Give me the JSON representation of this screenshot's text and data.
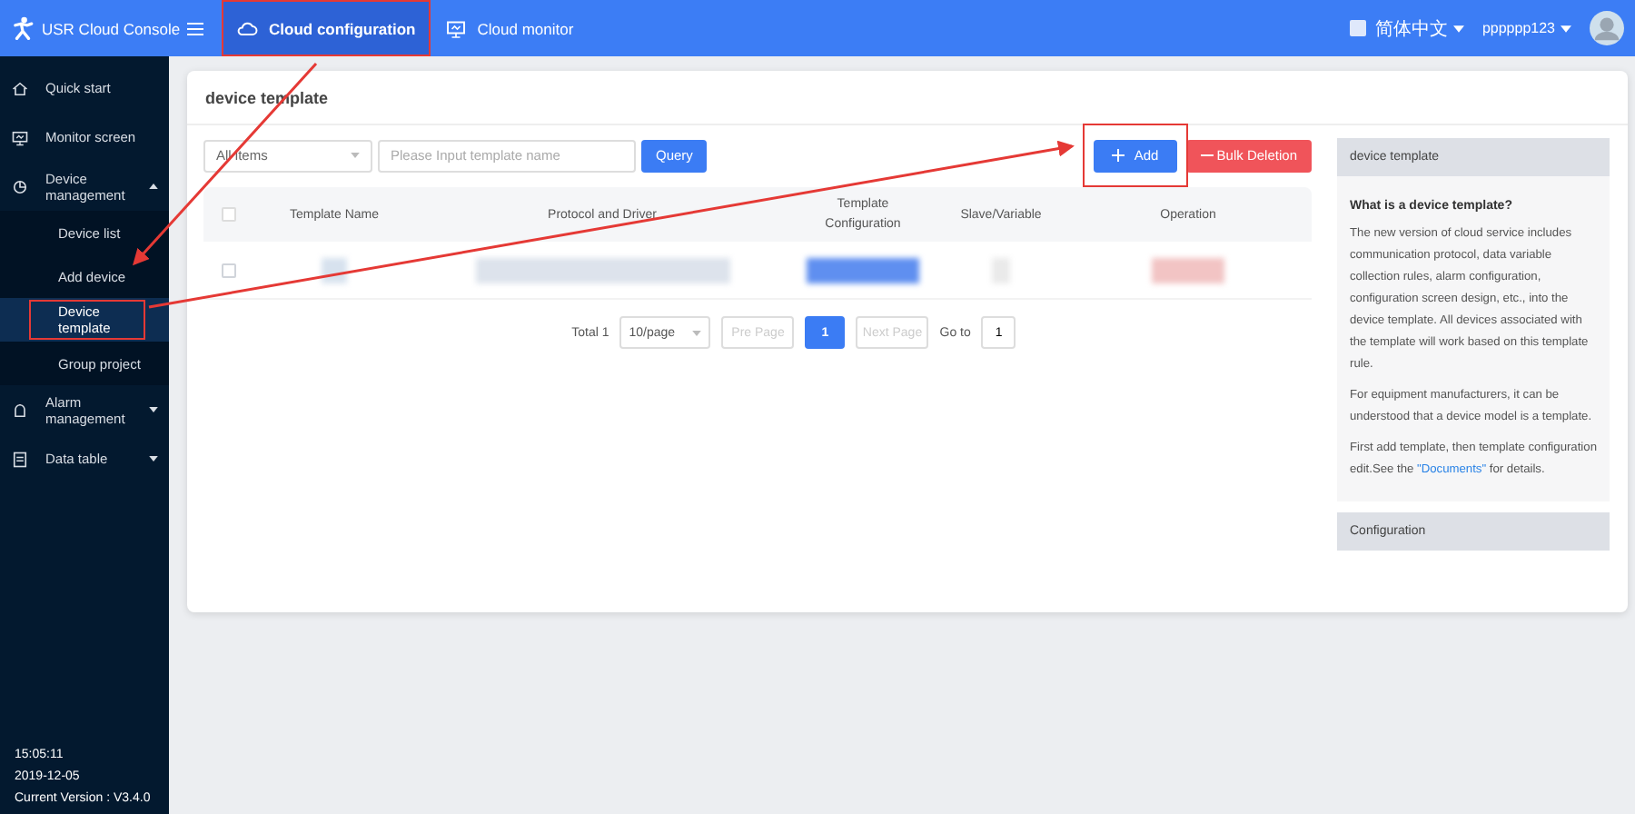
{
  "header": {
    "title": "USR Cloud Console",
    "tabs": [
      {
        "label": "Cloud configuration",
        "selected": true
      },
      {
        "label": "Cloud monitor",
        "selected": false
      }
    ],
    "language": "简体中文",
    "user": "pppppp123"
  },
  "sidebar": {
    "items": [
      {
        "label": "Quick start",
        "kind": "link"
      },
      {
        "label": "Monitor screen",
        "kind": "link"
      },
      {
        "label": "Device management",
        "kind": "group",
        "expanded": true,
        "children": [
          {
            "label": "Device list",
            "selected": false
          },
          {
            "label": "Add device",
            "selected": false
          },
          {
            "label": "Device template",
            "selected": true
          },
          {
            "label": "Group project",
            "selected": false
          }
        ]
      },
      {
        "label": "Alarm management",
        "kind": "group",
        "expanded": false
      },
      {
        "label": "Data table",
        "kind": "group",
        "expanded": false
      }
    ],
    "footer": [
      "15:05:11",
      "2019-12-05",
      "Current Version : V3.4.0"
    ]
  },
  "page": {
    "title": "device template",
    "filter": "All items",
    "search": {
      "placeholder": "Please Input template name"
    },
    "query_button": "Query",
    "add_button": "Add",
    "delete_button": "Bulk Deletion",
    "table": {
      "columns": [
        "Template Name",
        "Protocol and Driver",
        "Template Configuration",
        "Slave/Variable",
        "Operation"
      ],
      "all_checked": false,
      "rows": [
        {
          "checked": false
        }
      ]
    },
    "pagination": {
      "total": "Total 1",
      "page_size": "10/page",
      "prev": "Pre Page",
      "pages": [
        {
          "label": "1",
          "selected": true
        }
      ],
      "next": "Next Page",
      "goto_label": "Go to",
      "goto_value": "1"
    }
  },
  "help": {
    "title": "device template",
    "heading": "What is a device template?",
    "paragraphs": [
      {
        "text": "The new version of cloud service includes communication protocol, data variable collection rules, alarm configuration, configuration screen design, etc., into the device template. All devices associated with the template will work based on this template rule."
      },
      {
        "text": "For equipment manufacturers, it can be understood that a device model is a template."
      },
      {
        "text": "First add template, then template configuration edit.See the ",
        "link": "\"Documents\"",
        "after": " for details."
      }
    ],
    "section": "Configuration"
  }
}
